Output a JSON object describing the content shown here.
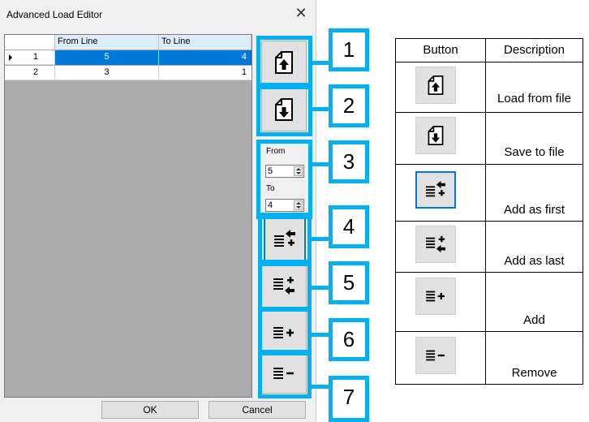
{
  "dialog": {
    "title": "Advanced Load Editor",
    "close_icon": "close-icon",
    "grid": {
      "columns": [
        "",
        "From Line",
        "To Line"
      ],
      "rows": [
        {
          "index": "1",
          "from_line": "5",
          "to_line": "4",
          "selected": true
        },
        {
          "index": "2",
          "from_line": "3",
          "to_line": "1",
          "selected": false
        }
      ]
    },
    "spin": {
      "from_label": "From",
      "from_value": "5",
      "to_label": "To",
      "to_value": "4"
    },
    "ok_label": "OK",
    "cancel_label": "Cancel"
  },
  "callouts": [
    "1",
    "2",
    "3",
    "4",
    "5",
    "6",
    "7"
  ],
  "reference_table": {
    "header_button": "Button",
    "header_description": "Description",
    "rows": [
      {
        "icon": "load-from-file-icon",
        "description": "Load from file"
      },
      {
        "icon": "save-to-file-icon",
        "description": "Save to file"
      },
      {
        "icon": "add-as-first-icon",
        "description": "Add as first"
      },
      {
        "icon": "add-as-last-icon",
        "description": "Add as last"
      },
      {
        "icon": "add-icon",
        "description": "Add"
      },
      {
        "icon": "remove-icon",
        "description": "Remove"
      }
    ]
  },
  "colors": {
    "callout_border": "#00b0f0",
    "selection": "#0078d7",
    "grid_background": "#ababab"
  }
}
